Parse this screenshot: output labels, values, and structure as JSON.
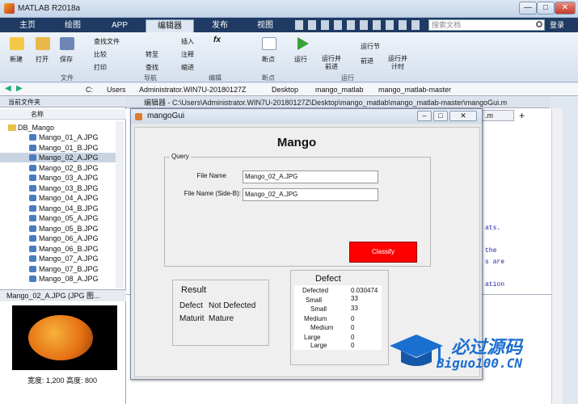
{
  "window": {
    "title": "MATLAB R2018a",
    "minimize": "—",
    "maximize": "□",
    "close": "✕"
  },
  "ribbon_tabs": [
    "主页",
    "绘图",
    "APP",
    "编辑器",
    "发布",
    "视图"
  ],
  "search_docs": {
    "placeholder": "搜索文档"
  },
  "login": "登录",
  "ribbon": {
    "new": "新建",
    "open": "打开",
    "save": "保存",
    "find_files": "查找文件",
    "compare": "比较",
    "print": "打印",
    "go_to": "转至",
    "find": "查找",
    "insert": "插入",
    "comment": "注释",
    "indent": "缩进",
    "breakpoints": "断点",
    "run": "运行",
    "run_and_advance": "运行并\n前进",
    "run_section": "运行节",
    "advance": "前进",
    "run_and_time": "运行并\n计时",
    "groups": {
      "file": "文件",
      "navigate": "导航",
      "edit": "编辑",
      "breakpoints": "断点",
      "run": "运行"
    }
  },
  "address": {
    "parts": [
      "C:",
      "Users",
      "Administrator.WIN7U-20180127Z",
      "Desktop",
      "mango_matlab",
      "mango_matlab-master"
    ]
  },
  "left_panel": {
    "header": "当前文件夹",
    "name_col": "名称",
    "folder": "DB_Mango",
    "files": [
      "Mango_01_A.JPG",
      "Mango_01_B.JPG",
      "Mango_02_A.JPG",
      "Mango_02_B.JPG",
      "Mango_03_A.JPG",
      "Mango_03_B.JPG",
      "Mango_04_A.JPG",
      "Mango_04_B.JPG",
      "Mango_05_A.JPG",
      "Mango_05_B.JPG",
      "Mango_06_A.JPG",
      "Mango_06_B.JPG",
      "Mango_07_A.JPG",
      "Mango_07_B.JPG",
      "Mango_08_A.JPG"
    ],
    "selected_index": 2,
    "detail": "Mango_02_A.JPG  (JPG 图...",
    "size": "宽度: 1,200  高度: 800"
  },
  "editor": {
    "path": "编辑器 - C:\\Users\\Administrator.WIN7U-20180127Z\\Desktop\\mango_matlab\\mango_matlab-master\\mangoGui.m",
    "tab_suffix": ".m",
    "code_snips": [
      "ats.",
      "the",
      "s are",
      "ation"
    ]
  },
  "gui": {
    "title": "mangoGui",
    "heading": "Mango",
    "query_label": "Query",
    "file_a_label": "File Name",
    "file_a_value": "Mango_02_A.JPG",
    "file_b_label": "File Name (Side-B):",
    "file_b_value": "Mango_02_A.JPG",
    "classify": "Classify",
    "result": {
      "title": "Result",
      "defect_label": "Defect",
      "defect_value": "Not Defected",
      "maturity_label": "Maturit",
      "maturity_value": "Mature"
    },
    "defect": {
      "title": "Defect",
      "rows": [
        {
          "k": "Defected",
          "v": "0.030474"
        },
        {
          "k": "Small",
          "v": "33"
        },
        {
          "k": "Small",
          "v": "33"
        },
        {
          "k": "Medium",
          "v": "0"
        },
        {
          "k": "Medium",
          "v": "0"
        },
        {
          "k": "Large",
          "v": "0"
        },
        {
          "k": "Large",
          "v": "0"
        }
      ]
    }
  },
  "watermark": {
    "cn": "必过源码",
    "url": "Biguo100.CN"
  },
  "colors": {
    "classify_bg": "#ff0000",
    "accent": "#1f3a63"
  }
}
